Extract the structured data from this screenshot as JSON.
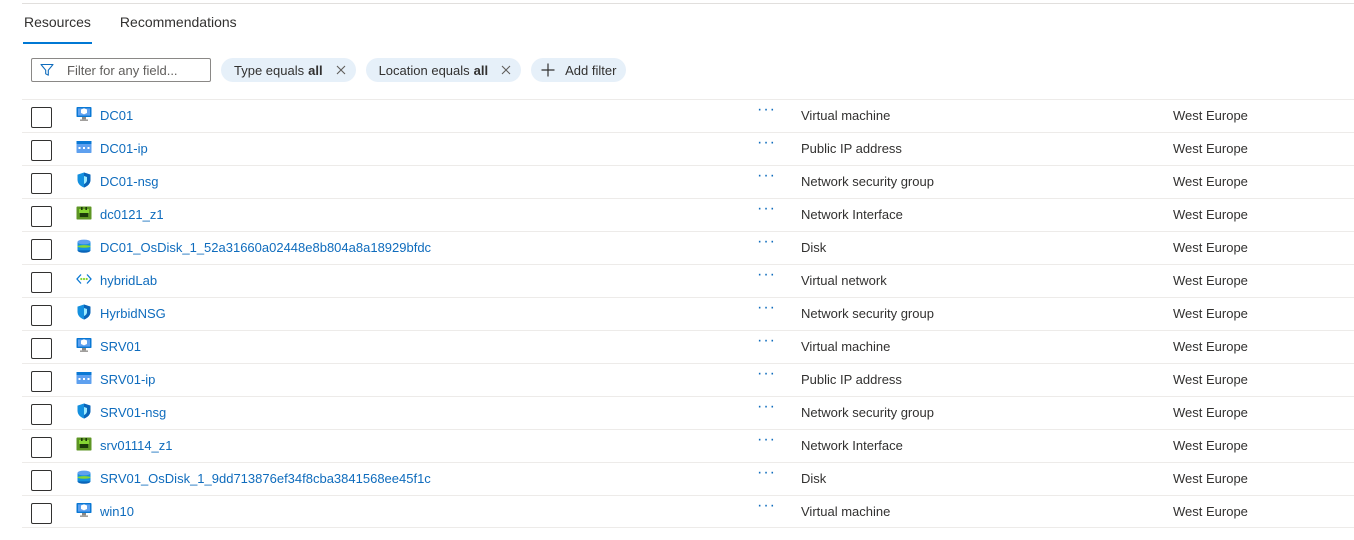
{
  "tabs": [
    {
      "label": "Resources",
      "active": true
    },
    {
      "label": "Recommendations",
      "active": false
    }
  ],
  "filter": {
    "placeholder": "Filter for any field...",
    "value": "",
    "pills": [
      {
        "prefix": "Type equals",
        "value": "all"
      },
      {
        "prefix": "Location equals",
        "value": "all"
      }
    ],
    "add_filter_label": "Add filter"
  },
  "colors": {
    "accent": "#0078d4",
    "link": "#0f6cbd",
    "pill_bg": "#e6f0f9"
  },
  "resources": [
    {
      "name": "DC01",
      "icon": "virtual-machine-icon",
      "type": "Virtual machine",
      "location": "West Europe"
    },
    {
      "name": "DC01-ip",
      "icon": "public-ip-icon",
      "type": "Public IP address",
      "location": "West Europe"
    },
    {
      "name": "DC01-nsg",
      "icon": "network-security-group-icon",
      "type": "Network security group",
      "location": "West Europe"
    },
    {
      "name": "dc0121_z1",
      "icon": "network-interface-icon",
      "type": "Network Interface",
      "location": "West Europe"
    },
    {
      "name": "DC01_OsDisk_1_52a31660a02448e8b804a8a18929bfdc",
      "icon": "disk-icon",
      "type": "Disk",
      "location": "West Europe"
    },
    {
      "name": "hybridLab",
      "icon": "virtual-network-icon",
      "type": "Virtual network",
      "location": "West Europe"
    },
    {
      "name": "HyrbidNSG",
      "icon": "network-security-group-icon",
      "type": "Network security group",
      "location": "West Europe"
    },
    {
      "name": "SRV01",
      "icon": "virtual-machine-icon",
      "type": "Virtual machine",
      "location": "West Europe"
    },
    {
      "name": "SRV01-ip",
      "icon": "public-ip-icon",
      "type": "Public IP address",
      "location": "West Europe"
    },
    {
      "name": "SRV01-nsg",
      "icon": "network-security-group-icon",
      "type": "Network security group",
      "location": "West Europe"
    },
    {
      "name": "srv01114_z1",
      "icon": "network-interface-icon",
      "type": "Network Interface",
      "location": "West Europe"
    },
    {
      "name": "SRV01_OsDisk_1_9dd713876ef34f8cba3841568ee45f1c",
      "icon": "disk-icon",
      "type": "Disk",
      "location": "West Europe"
    },
    {
      "name": "win10",
      "icon": "virtual-machine-icon",
      "type": "Virtual machine",
      "location": "West Europe"
    }
  ],
  "more_glyph": "···"
}
